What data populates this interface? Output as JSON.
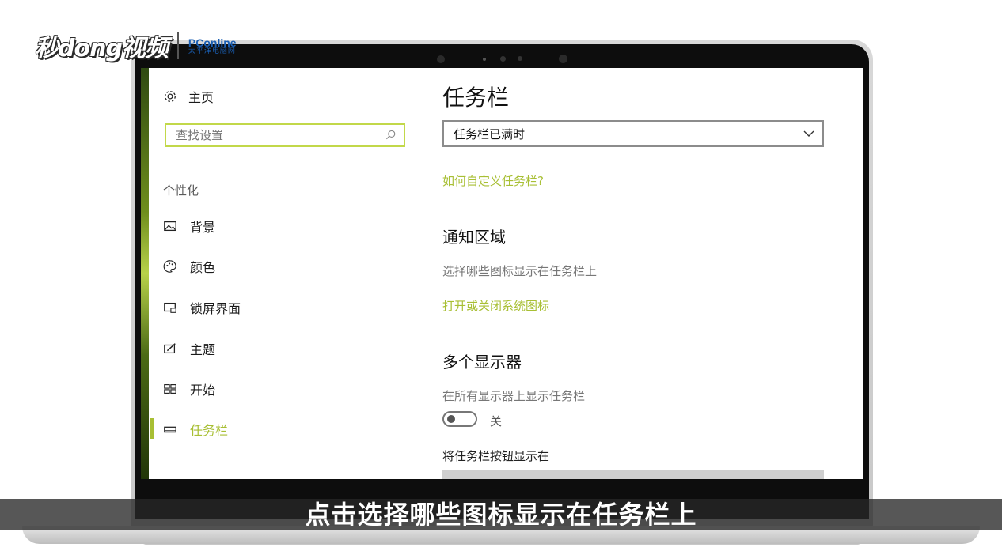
{
  "watermark": {
    "brand": "秒dong视频",
    "partner_top": "PConline",
    "partner_bottom": "太平洋电脑网"
  },
  "sidebar": {
    "home_label": "主页",
    "search_placeholder": "查找设置",
    "section_label": "个性化",
    "items": [
      {
        "label": "背景",
        "icon": "picture-icon"
      },
      {
        "label": "颜色",
        "icon": "palette-icon"
      },
      {
        "label": "锁屏界面",
        "icon": "lock-screen-icon"
      },
      {
        "label": "主题",
        "icon": "theme-icon"
      },
      {
        "label": "开始",
        "icon": "start-icon"
      },
      {
        "label": "任务栏",
        "icon": "taskbar-icon",
        "active": true
      }
    ]
  },
  "main": {
    "title": "任务栏",
    "dropdown_value": "任务栏已满时",
    "customize_link": "如何自定义任务栏?",
    "notification_area": {
      "title": "通知区域",
      "select_icons_link": "选择哪些图标显示在任务栏上",
      "system_icons_link": "打开或关闭系统图标"
    },
    "multi_display": {
      "title": "多个显示器",
      "show_taskbar_label": "在所有显示器上显示任务栏",
      "toggle_state": "关",
      "buttons_label": "将任务栏按钮显示在"
    }
  },
  "caption": "点击选择哪些图标显示在任务栏上",
  "colors": {
    "accent": "#a8bf34",
    "search_border": "#c2d84a",
    "caption_band": "#282828"
  }
}
